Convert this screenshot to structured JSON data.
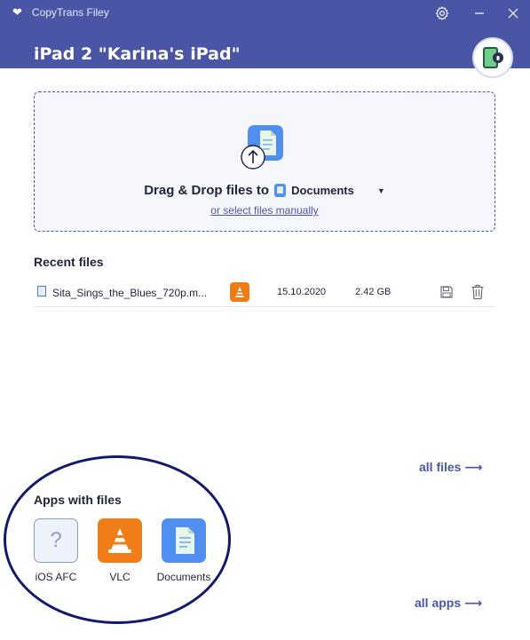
{
  "window": {
    "app_title": "CopyTrans Filey",
    "device_title": "iPad 2 \"Karina's iPad\"",
    "icons": [
      "heart-icon",
      "gear-icon",
      "minimize-icon",
      "close-icon",
      "device-icon"
    ]
  },
  "dropzone": {
    "prompt": "Drag & Drop files to",
    "target_app": "Documents",
    "select_link": "or select files manually"
  },
  "recent": {
    "heading": "Recent files",
    "files": [
      {
        "name": "Sita_Sings_the_Blues_720p.m...",
        "app": "VLC",
        "date": "15.10.2020",
        "size": "2.42 GB"
      }
    ]
  },
  "links": {
    "all_files": "all files ⟶",
    "all_apps": "all apps ⟶"
  },
  "apps": {
    "heading": "Apps with files",
    "items": [
      {
        "label": "iOS AFC",
        "icon": "question-icon",
        "glyph": "?"
      },
      {
        "label": "VLC",
        "icon": "vlc-cone-icon"
      },
      {
        "label": "Documents",
        "icon": "documents-icon"
      }
    ]
  },
  "colors": {
    "brand": "#4b55a5",
    "vlc_orange": "#f07d17",
    "documents_blue": "#4e8ff0",
    "highlight": "#14196b"
  }
}
